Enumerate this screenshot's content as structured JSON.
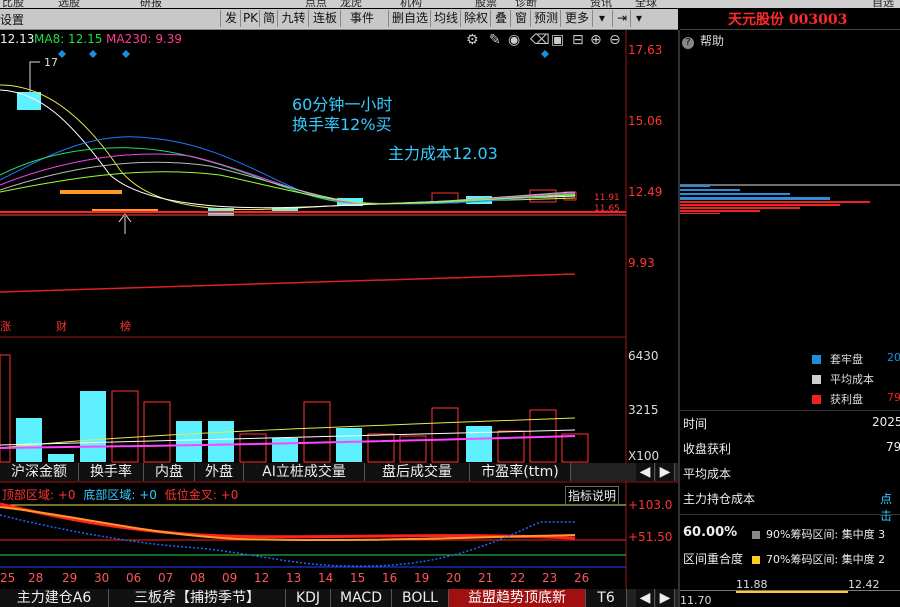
{
  "top_strip": [
    "比股",
    "选股",
    "研报",
    "点点",
    "龙虎",
    "机构",
    "股票",
    "诊断",
    "资讯",
    "全球",
    "自选"
  ],
  "toolbar": {
    "settings_label": "设置",
    "buttons": [
      "发",
      "PK",
      "简",
      "九转",
      "连板",
      "事件",
      "删自选",
      "均线",
      "除权",
      "叠",
      "窗",
      "预测",
      "更多"
    ]
  },
  "stock": {
    "name": "天元股份",
    "code": "003003",
    "title": "天元股份 003003"
  },
  "ma_legend": {
    "ma_prev": "12.13",
    "ma8": "MA8: 12.15",
    "ma230": "MA230: 9.39"
  },
  "price_axis": [
    "17.63",
    "15.06",
    "12.49",
    "9.93"
  ],
  "price_tags": [
    "11.91",
    "11.65"
  ],
  "peak_label": "17",
  "annotations": {
    "line1": "60分钟一小时",
    "line2": "换手率12%买",
    "line3": "主力成本12.03"
  },
  "event_markers": [
    "涨",
    "财",
    "榜"
  ],
  "volume_axis": [
    "6430",
    "3215",
    "X100"
  ],
  "indicator_tabs": [
    "沪深金额",
    "换手率",
    "内盘",
    "外盘",
    "AI立桩成交量",
    "盘后成交量",
    "市盈率(ttm)"
  ],
  "signal_legend": {
    "top": "顶部区域: +0",
    "bottom": "底部区域: +0",
    "golden": "低位金叉: +0",
    "help": "指标说明"
  },
  "signal_axis": [
    "+103.0",
    "+51.50"
  ],
  "dates": [
    "25",
    "28",
    "29",
    "30",
    "06",
    "07",
    "08",
    "09",
    "12",
    "13",
    "14",
    "15",
    "16",
    "19",
    "20",
    "21",
    "22",
    "23",
    "26"
  ],
  "bottom_tabs": [
    "主力建仓A6",
    "三板斧【捕捞季节】",
    "KDJ",
    "MACD",
    "BOLL",
    "益盟趋势顶底新",
    "T6"
  ],
  "right_panel": {
    "help": "帮助",
    "legend": [
      {
        "label": "套牢盘",
        "value": "20",
        "color": "#1e8fd6"
      },
      {
        "label": "平均成本",
        "value": "",
        "color": "#d0d0d0"
      },
      {
        "label": "获利盘",
        "value": "79",
        "color": "#ee2222"
      }
    ],
    "rows": [
      {
        "label": "时间",
        "value": "2025"
      },
      {
        "label": "收盘获利",
        "value": "79"
      },
      {
        "label": "平均成本",
        "value": ""
      },
      {
        "label": "主力持仓成本",
        "value": "点击"
      }
    ],
    "concentration": {
      "percent": "60.00%",
      "range90": "90%筹码区间: 集中度 3",
      "overlap_label": "区间重合度",
      "range70": "70%筹码区间: 集中度 2"
    },
    "price_ticks": [
      "11.88",
      "12.42"
    ],
    "corner_price": "11.70"
  }
}
